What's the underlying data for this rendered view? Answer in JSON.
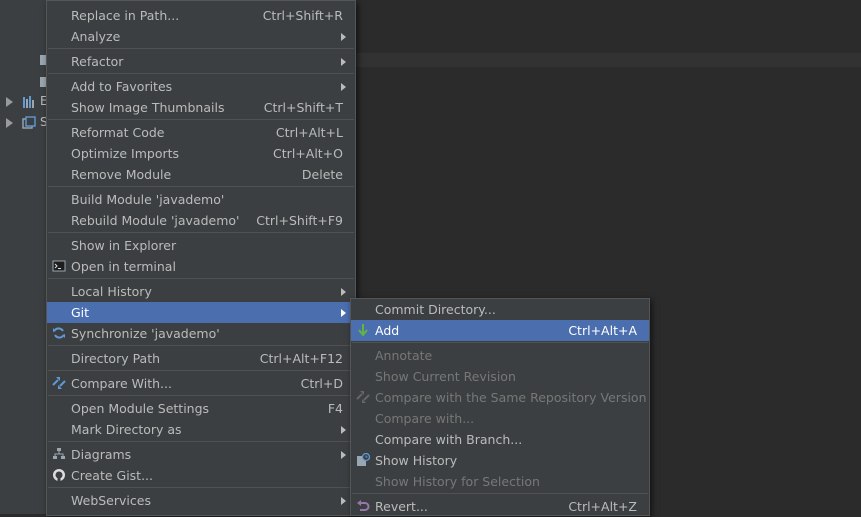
{
  "tree": [
    {
      "name": "tree-item-1",
      "letter": "",
      "icon": "file-icon"
    },
    {
      "name": "tree-item-2",
      "letter": "",
      "icon": "file-icon"
    },
    {
      "name": "tree-item-external-libraries",
      "letter": "E",
      "icon": "library-icon"
    },
    {
      "name": "tree-item-scratches",
      "letter": "S",
      "icon": "scratches-icon"
    }
  ],
  "context_menu": {
    "items": [
      {
        "label": "Replace in Path...",
        "shortcut": "Ctrl+Shift+R"
      },
      {
        "label": "Analyze",
        "submenu": true
      },
      {
        "label": "Refactor",
        "submenu": true
      },
      {
        "label": "Add to Favorites",
        "submenu": true
      },
      {
        "label": "Show Image Thumbnails",
        "shortcut": "Ctrl+Shift+T"
      },
      {
        "label": "Reformat Code",
        "shortcut": "Ctrl+Alt+L"
      },
      {
        "label": "Optimize Imports",
        "shortcut": "Ctrl+Alt+O"
      },
      {
        "label": "Remove Module",
        "shortcut": "Delete"
      },
      {
        "label": "Build Module 'javademo'"
      },
      {
        "label": "Rebuild Module 'javademo'",
        "shortcut": "Ctrl+Shift+F9"
      },
      {
        "label": "Show in Explorer"
      },
      {
        "label": "Open in terminal",
        "icon": "terminal-icon"
      },
      {
        "label": "Local History",
        "submenu": true
      },
      {
        "label": "Git",
        "submenu": true,
        "selected": true
      },
      {
        "label": "Synchronize 'javademo'",
        "icon": "sync-icon"
      },
      {
        "label": "Directory Path",
        "shortcut": "Ctrl+Alt+F12"
      },
      {
        "label": "Compare With...",
        "shortcut": "Ctrl+D",
        "icon": "compare-icon"
      },
      {
        "label": "Open Module Settings",
        "shortcut": "F4"
      },
      {
        "label": "Mark Directory as",
        "submenu": true
      },
      {
        "label": "Diagrams",
        "submenu": true,
        "icon": "diagram-icon"
      },
      {
        "label": "Create Gist...",
        "icon": "github-icon"
      },
      {
        "label": "WebServices",
        "submenu": true
      }
    ]
  },
  "git_submenu": {
    "items": [
      {
        "label": "Commit Directory..."
      },
      {
        "label": "Add",
        "shortcut": "Ctrl+Alt+A",
        "selected": true,
        "icon": "add-icon"
      },
      {
        "label": "Annotate",
        "disabled": true
      },
      {
        "label": "Show Current Revision",
        "disabled": true
      },
      {
        "label": "Compare with the Same Repository Version",
        "disabled": true,
        "icon": "compare-icon"
      },
      {
        "label": "Compare with...",
        "disabled": true
      },
      {
        "label": "Compare with Branch..."
      },
      {
        "label": "Show History",
        "icon": "history-icon"
      },
      {
        "label": "Show History for Selection",
        "disabled": true
      },
      {
        "label": "Revert...",
        "shortcut": "Ctrl+Alt+Z",
        "icon": "revert-icon"
      }
    ]
  }
}
